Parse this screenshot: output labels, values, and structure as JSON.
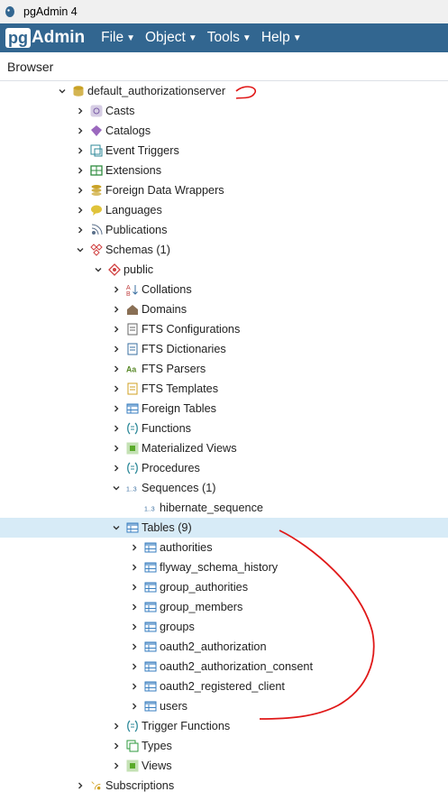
{
  "window": {
    "title": "pgAdmin 4"
  },
  "menubar": {
    "logo_pg": "pg",
    "logo_admin": "Admin",
    "items": [
      "File",
      "Object",
      "Tools",
      "Help"
    ]
  },
  "panel": {
    "title": "Browser"
  },
  "colors": {
    "menubar": "#326690",
    "selected_row": "#d7ebf7",
    "annotation": "#e01818"
  },
  "tree": [
    {
      "label": "default_authorizationserver",
      "depth": 0,
      "toggle": "expanded",
      "icon": "database-icon",
      "color": "#c9a227"
    },
    {
      "label": "Casts",
      "depth": 1,
      "toggle": "collapsed",
      "icon": "cast-icon",
      "color": "#7b5ea7"
    },
    {
      "label": "Catalogs",
      "depth": 1,
      "toggle": "collapsed",
      "icon": "catalog-icon",
      "color": "#8a4db3"
    },
    {
      "label": "Event Triggers",
      "depth": 1,
      "toggle": "collapsed",
      "icon": "event-trigger-icon",
      "color": "#2f8a9a"
    },
    {
      "label": "Extensions",
      "depth": 1,
      "toggle": "collapsed",
      "icon": "extension-icon",
      "color": "#2e8b3e"
    },
    {
      "label": "Foreign Data Wrappers",
      "depth": 1,
      "toggle": "collapsed",
      "icon": "fdw-icon",
      "color": "#c9a227"
    },
    {
      "label": "Languages",
      "depth": 1,
      "toggle": "collapsed",
      "icon": "language-icon",
      "color": "#e0c33a"
    },
    {
      "label": "Publications",
      "depth": 1,
      "toggle": "collapsed",
      "icon": "publication-icon",
      "color": "#5a6f8a"
    },
    {
      "label": "Schemas (1)",
      "depth": 1,
      "toggle": "expanded",
      "icon": "schemas-icon",
      "color": "#d04040"
    },
    {
      "label": "public",
      "depth": 2,
      "toggle": "expanded",
      "icon": "schema-icon",
      "color": "#d04040"
    },
    {
      "label": "Collations",
      "depth": 3,
      "toggle": "collapsed",
      "icon": "collation-icon",
      "color": "#c04040"
    },
    {
      "label": "Domains",
      "depth": 3,
      "toggle": "collapsed",
      "icon": "domain-icon",
      "color": "#6b4b2a"
    },
    {
      "label": "FTS Configurations",
      "depth": 3,
      "toggle": "collapsed",
      "icon": "fts-config-icon",
      "color": "#666666"
    },
    {
      "label": "FTS Dictionaries",
      "depth": 3,
      "toggle": "collapsed",
      "icon": "fts-dictionary-icon",
      "color": "#3a6fa0"
    },
    {
      "label": "FTS Parsers",
      "depth": 3,
      "toggle": "collapsed",
      "icon": "fts-parser-icon",
      "color": "#5a8a2a"
    },
    {
      "label": "FTS Templates",
      "depth": 3,
      "toggle": "collapsed",
      "icon": "fts-template-icon",
      "color": "#d0a020"
    },
    {
      "label": "Foreign Tables",
      "depth": 3,
      "toggle": "collapsed",
      "icon": "foreign-table-icon",
      "color": "#3a7fc0"
    },
    {
      "label": "Functions",
      "depth": 3,
      "toggle": "collapsed",
      "icon": "function-icon",
      "color": "#2f8a9a"
    },
    {
      "label": "Materialized Views",
      "depth": 3,
      "toggle": "collapsed",
      "icon": "materialized-view-icon",
      "color": "#5aaa2a"
    },
    {
      "label": "Procedures",
      "depth": 3,
      "toggle": "collapsed",
      "icon": "procedure-icon",
      "color": "#2f8a9a"
    },
    {
      "label": "Sequences (1)",
      "depth": 3,
      "toggle": "expanded",
      "icon": "sequence-icon",
      "color": "#3a6fa0"
    },
    {
      "label": "hibernate_sequence",
      "depth": 4,
      "toggle": "none",
      "icon": "sequence-icon",
      "color": "#3a6fa0"
    },
    {
      "label": "Tables (9)",
      "depth": 3,
      "toggle": "expanded",
      "icon": "tables-icon",
      "color": "#3a7fc0",
      "selected": true
    },
    {
      "label": "authorities",
      "depth": 4,
      "toggle": "collapsed",
      "icon": "table-icon",
      "color": "#3a7fc0"
    },
    {
      "label": "flyway_schema_history",
      "depth": 4,
      "toggle": "collapsed",
      "icon": "table-icon",
      "color": "#3a7fc0"
    },
    {
      "label": "group_authorities",
      "depth": 4,
      "toggle": "collapsed",
      "icon": "table-icon",
      "color": "#3a7fc0"
    },
    {
      "label": "group_members",
      "depth": 4,
      "toggle": "collapsed",
      "icon": "table-icon",
      "color": "#3a7fc0"
    },
    {
      "label": "groups",
      "depth": 4,
      "toggle": "collapsed",
      "icon": "table-icon",
      "color": "#3a7fc0"
    },
    {
      "label": "oauth2_authorization",
      "depth": 4,
      "toggle": "collapsed",
      "icon": "table-icon",
      "color": "#3a7fc0"
    },
    {
      "label": "oauth2_authorization_consent",
      "depth": 4,
      "toggle": "collapsed",
      "icon": "table-icon",
      "color": "#3a7fc0"
    },
    {
      "label": "oauth2_registered_client",
      "depth": 4,
      "toggle": "collapsed",
      "icon": "table-icon",
      "color": "#3a7fc0"
    },
    {
      "label": "users",
      "depth": 4,
      "toggle": "collapsed",
      "icon": "table-icon",
      "color": "#3a7fc0"
    },
    {
      "label": "Trigger Functions",
      "depth": 3,
      "toggle": "collapsed",
      "icon": "trigger-function-icon",
      "color": "#2f8a9a"
    },
    {
      "label": "Types",
      "depth": 3,
      "toggle": "collapsed",
      "icon": "type-icon",
      "color": "#2e9a3e"
    },
    {
      "label": "Views",
      "depth": 3,
      "toggle": "collapsed",
      "icon": "view-icon",
      "color": "#5aaa2a"
    },
    {
      "label": "Subscriptions",
      "depth": 1,
      "toggle": "collapsed",
      "icon": "subscription-icon",
      "color": "#d0a020"
    }
  ]
}
